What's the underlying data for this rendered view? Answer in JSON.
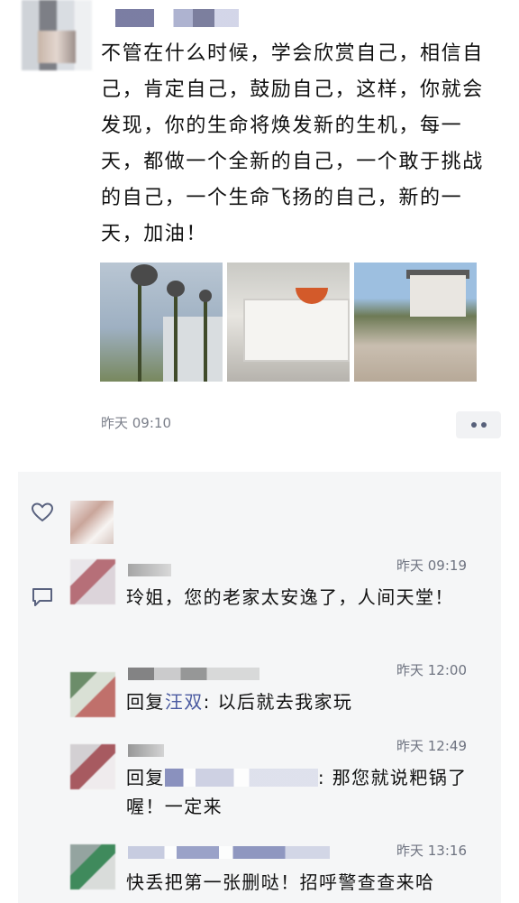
{
  "post": {
    "text": "不管在什么时候，学会欣赏自己，相信自己，肯定自己，鼓励自己，这样，你就会发现，你的生命将焕发新的生机，每一天，都做一个全新的自己，一个敢于挑战的自己，一个生命飞扬的自己，新的一天，加油！",
    "timestamp": "昨天 09:10"
  },
  "comments": [
    {
      "time": "昨天 09:19",
      "text": "玲姐，您的老家太安逸了，人间天堂！"
    },
    {
      "time": "昨天 12:00",
      "prefix": "回复",
      "reply_to": "汪双",
      "text": ": 以后就去我家玩"
    },
    {
      "time": "昨天 12:49",
      "prefix": "回复",
      "text": ": 那您就说粑锅了喔！一定来"
    },
    {
      "time": "昨天 13:16",
      "text": "快丢把第一张删哒！招呼警查查来哈"
    }
  ],
  "colors": {
    "panel_bg": "#f5f6f7",
    "link": "#4a5aa0",
    "meta_text": "#7b7f8a"
  },
  "icons": [
    "heart-icon",
    "comment-icon",
    "more-dots-icon"
  ]
}
